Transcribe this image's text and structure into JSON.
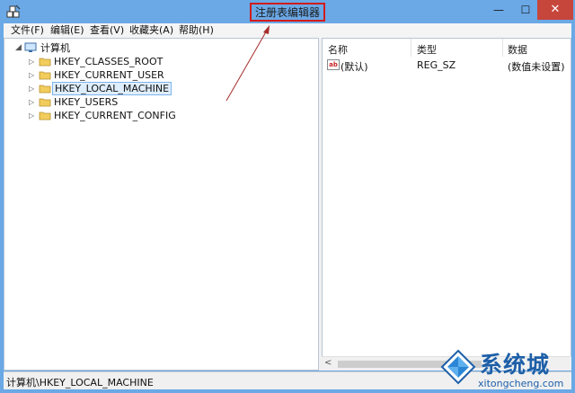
{
  "window": {
    "title": "注册表编辑器",
    "controls": {
      "minimize": "—",
      "maximize": "☐",
      "close": "✕"
    }
  },
  "menu": [
    "文件(F)",
    "编辑(E)",
    "查看(V)",
    "收藏夹(A)",
    "帮助(H)"
  ],
  "tree": {
    "root": "计算机",
    "items": [
      "HKEY_CLASSES_ROOT",
      "HKEY_CURRENT_USER",
      "HKEY_LOCAL_MACHINE",
      "HKEY_USERS",
      "HKEY_CURRENT_CONFIG"
    ],
    "selected": "HKEY_LOCAL_MACHINE"
  },
  "list": {
    "columns": [
      "名称",
      "类型",
      "数据"
    ],
    "rows": [
      {
        "icon": "ab",
        "name": "(默认)",
        "type": "REG_SZ",
        "data": "(数值未设置)"
      }
    ]
  },
  "status": "计算机\\HKEY_LOCAL_MACHINE",
  "watermark": {
    "brand": "系统城",
    "url": "xitongcheng.com"
  },
  "colors": {
    "titlebar": "#6aa8e6",
    "highlight_box": "#d11c1c",
    "selection": "#dfeefc",
    "brand": "#1d5fa8"
  }
}
